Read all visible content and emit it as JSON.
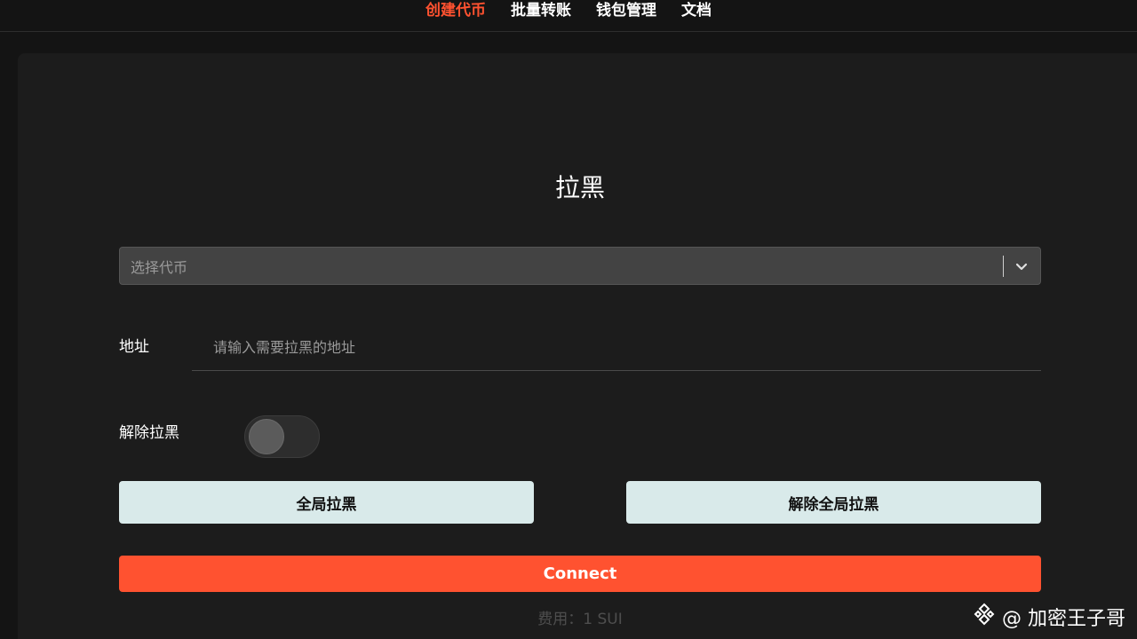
{
  "nav": {
    "items": [
      {
        "label": "创建代币",
        "active": true
      },
      {
        "label": "批量转账",
        "active": false
      },
      {
        "label": "钱包管理",
        "active": false
      },
      {
        "label": "文档",
        "active": false
      }
    ]
  },
  "page": {
    "title": "拉黑"
  },
  "token_select": {
    "placeholder": "选择代币",
    "icon": "chevron-down-icon"
  },
  "address": {
    "label": "地址",
    "placeholder": "请输入需要拉黑的地址",
    "value": ""
  },
  "unblacklist": {
    "label": "解除拉黑",
    "enabled": false
  },
  "buttons": {
    "global_blacklist": "全局拉黑",
    "remove_global_blacklist": "解除全局拉黑",
    "connect": "Connect"
  },
  "fee": {
    "text": "费用：1 SUI"
  },
  "watermark": {
    "text": "@ 加密王子哥",
    "icon": "binance-logo-icon"
  },
  "colors": {
    "accent": "#ff5230",
    "background": "#141414",
    "card": "#1c1c1c",
    "light_button": "#d9eaea"
  }
}
